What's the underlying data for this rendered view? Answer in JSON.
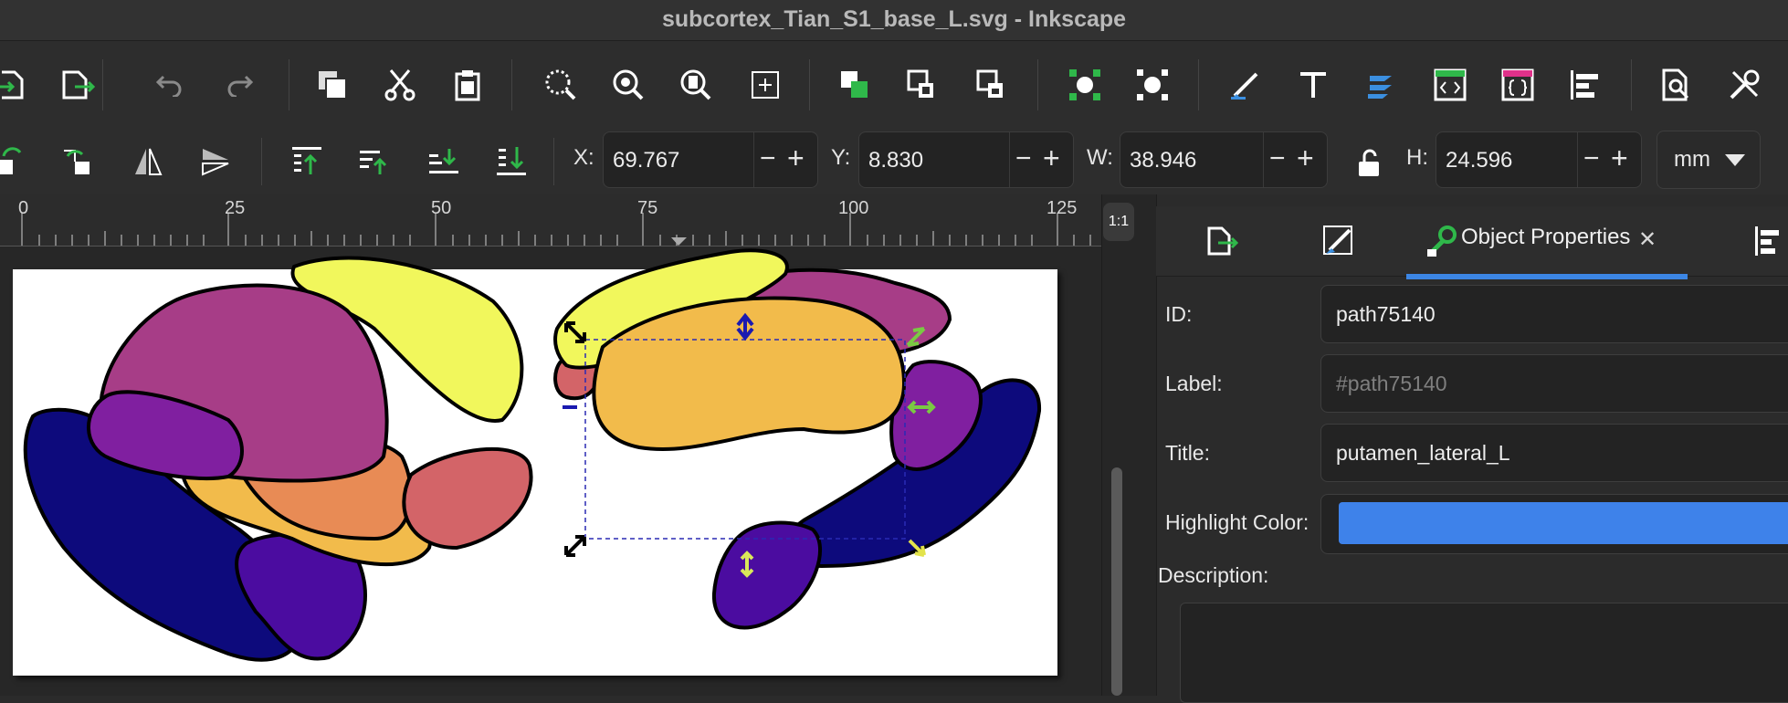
{
  "window": {
    "title": "subcortex_Tian_S1_base_L.svg - Inkscape"
  },
  "toolbar": {
    "commands": [
      {
        "name": "import-icon",
        "color": "#ffffff"
      },
      {
        "name": "export-icon",
        "color": "#ffffff"
      },
      {
        "name": "undo-icon",
        "color": "#8a8a8a"
      },
      {
        "name": "redo-icon",
        "color": "#8a8a8a"
      },
      {
        "name": "copy-icon",
        "color": "#ffffff"
      },
      {
        "name": "cut-icon",
        "color": "#ffffff"
      },
      {
        "name": "paste-icon",
        "color": "#ffffff"
      },
      {
        "name": "zoom-selection-icon",
        "color": "#ffffff"
      },
      {
        "name": "zoom-drawing-icon",
        "color": "#ffffff"
      },
      {
        "name": "zoom-page-icon",
        "color": "#ffffff"
      },
      {
        "name": "zoom-center-icon",
        "color": "#ffffff"
      },
      {
        "name": "group-icon",
        "color": "#2fb84a"
      },
      {
        "name": "lock-icon",
        "color": "#ffffff"
      },
      {
        "name": "unlock-icon",
        "color": "#ffffff"
      },
      {
        "name": "node-editor-icon",
        "color": "#2fb84a"
      },
      {
        "name": "select-same-icon",
        "color": "#ffffff"
      },
      {
        "name": "fill-stroke-icon",
        "color": "#3b8fe0"
      },
      {
        "name": "text-icon",
        "color": "#ffffff"
      },
      {
        "name": "layers-icon",
        "color": "#3b8fe0"
      },
      {
        "name": "xml-editor-icon",
        "color": "#2fb84a"
      },
      {
        "name": "selectors-css-icon",
        "color": "#e0318a"
      },
      {
        "name": "align-icon",
        "color": "#ffffff"
      },
      {
        "name": "document-properties-icon",
        "color": "#ffffff"
      },
      {
        "name": "preferences-icon",
        "color": "#ffffff"
      }
    ]
  },
  "transform_bar": {
    "x_label": "X:",
    "x_value": "69.767",
    "y_label": "Y:",
    "y_value": "8.830",
    "w_label": "W:",
    "w_value": "38.946",
    "h_label": "H:",
    "h_value": "24.596",
    "unit": "mm",
    "minus": "−",
    "plus": "+"
  },
  "ruler": {
    "labels": [
      "0",
      "25",
      "50",
      "75",
      "100",
      "125"
    ]
  },
  "zoom_button": "1:1",
  "panel": {
    "active_tab": "Object Properties",
    "close": "✕",
    "id_label": "ID:",
    "id_value": "path75140",
    "label_label": "Label:",
    "label_placeholder": "#path75140",
    "title_label": "Title:",
    "title_value": "putamen_lateral_L",
    "highlight_label": "Highlight Color:",
    "highlight_color": "#3e82ea",
    "description_label": "Description:"
  },
  "drawing": {
    "colors": {
      "navy": "#0d0a7c",
      "indigo": "#4b0ca0",
      "purple": "#801fa0",
      "magenta": "#a73d87",
      "orange_yellow": "#f2bb4b",
      "orange": "#e88b55",
      "salmon": "#d36468",
      "yellow": "#f1f75c"
    }
  }
}
